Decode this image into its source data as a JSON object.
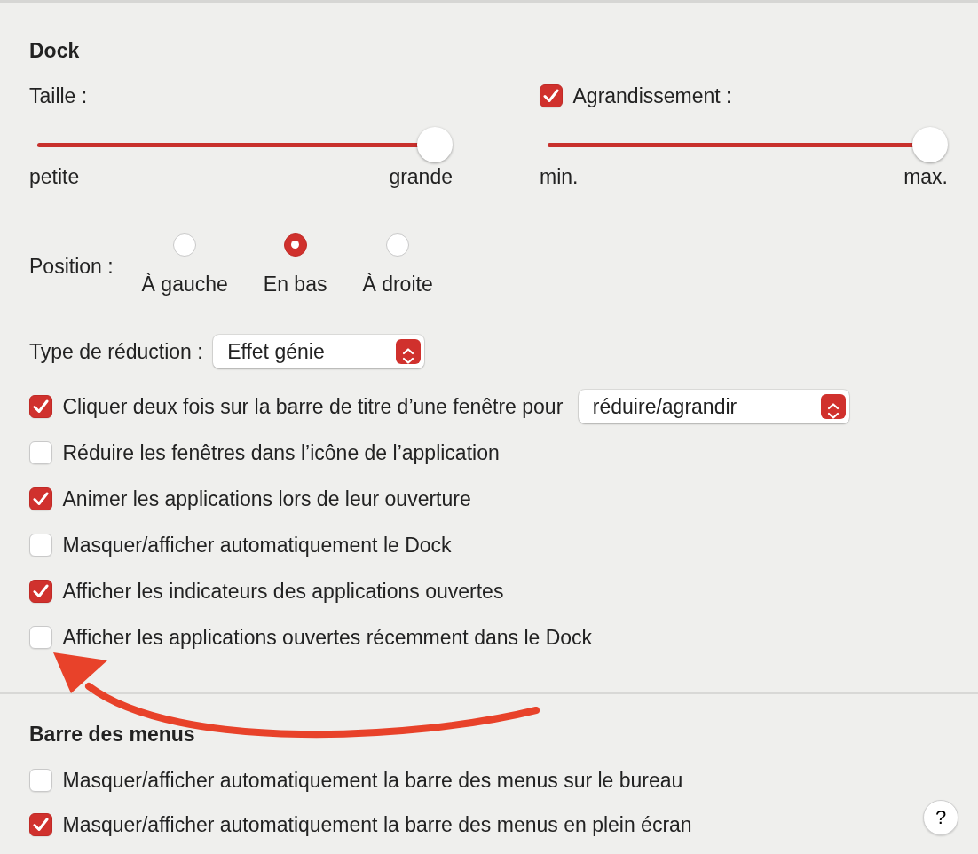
{
  "dock": {
    "title": "Dock",
    "size": {
      "label": "Taille :",
      "level": 1.0,
      "min_label": "petite",
      "max_label": "grande"
    },
    "magnification": {
      "label": "Agrandissement :",
      "checked": true,
      "level": 1.0,
      "min_label": "min.",
      "max_label": "max."
    },
    "position": {
      "label": "Position :",
      "options": [
        {
          "label": "À gauche",
          "selected": false
        },
        {
          "label": "En bas",
          "selected": true
        },
        {
          "label": "À droite",
          "selected": false
        }
      ]
    },
    "minimize_effect": {
      "label": "Type de réduction :",
      "value": "Effet génie"
    },
    "options": [
      {
        "kind": "select",
        "label": "Cliquer deux fois sur la barre de titre d’une fenêtre pour",
        "checked": true,
        "value": "réduire/agrandir"
      },
      {
        "kind": "checkbox",
        "label": "Réduire les fenêtres dans l’icône de l’application",
        "checked": false
      },
      {
        "kind": "checkbox",
        "label": "Animer les applications lors de leur ouverture",
        "checked": true
      },
      {
        "kind": "checkbox",
        "label": "Masquer/afficher automatiquement le Dock",
        "checked": false
      },
      {
        "kind": "checkbox",
        "label": "Afficher les indicateurs des applications ouvertes",
        "checked": true
      },
      {
        "kind": "checkbox",
        "label": "Afficher les applications ouvertes récemment dans le Dock",
        "checked": false
      }
    ]
  },
  "menu_bar": {
    "title": "Barre des menus",
    "options": [
      {
        "label": "Masquer/afficher automatiquement la barre des menus sur le bureau",
        "checked": false
      },
      {
        "label": "Masquer/afficher automatiquement la barre des menus en plein écran",
        "checked": true
      }
    ]
  },
  "help_button": {
    "label": "?"
  }
}
